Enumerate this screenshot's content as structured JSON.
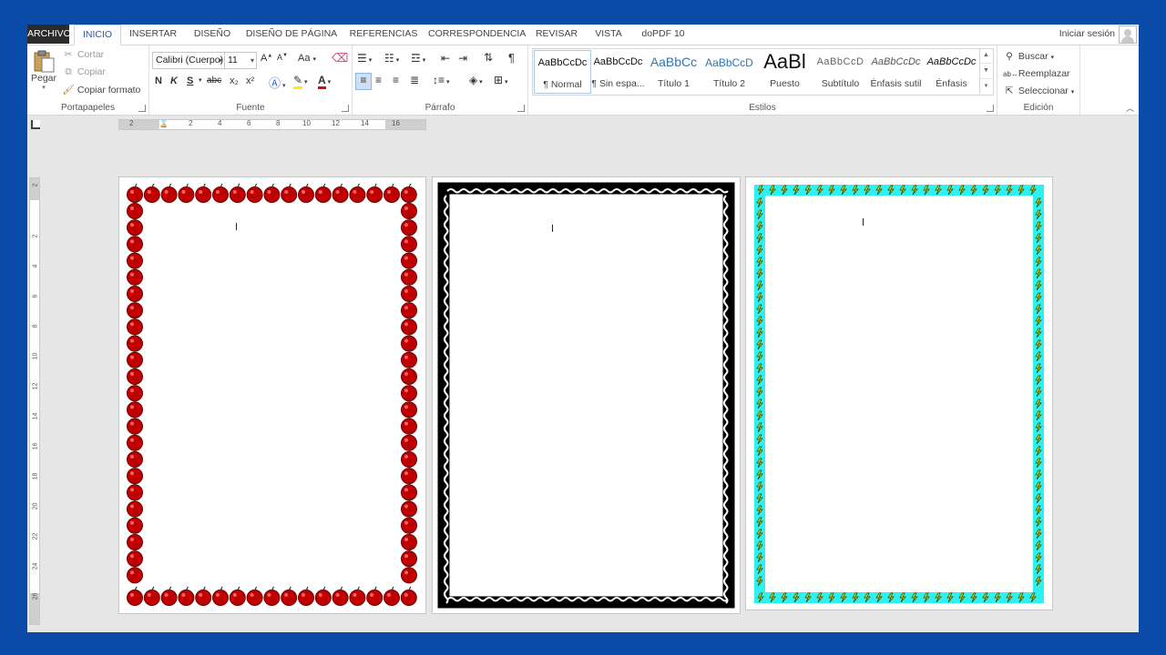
{
  "tabs": [
    "ARCHIVO",
    "INICIO",
    "INSERTAR",
    "DISEÑO",
    "DISEÑO DE PÁGINA",
    "REFERENCIAS",
    "CORRESPONDENCIA",
    "REVISAR",
    "VISTA",
    "doPDF 10"
  ],
  "active_tab": "INICIO",
  "signin": "Iniciar sesión",
  "clipboard": {
    "paste": "Pegar",
    "cut": "Cortar",
    "copy": "Copiar",
    "format_painter": "Copiar formato",
    "label": "Portapapeles"
  },
  "font": {
    "name": "Calibri (Cuerpo)",
    "size": "11",
    "bold": "N",
    "italic": "K",
    "underline": "S",
    "strike": "abc",
    "sub": "x₂",
    "sup": "x²",
    "case": "Aa",
    "label": "Fuente"
  },
  "paragraph": {
    "label": "Párrafo",
    "pilcrow": "¶"
  },
  "styles": {
    "label": "Estilos",
    "items": [
      {
        "sample": "AaBbCcDc",
        "name": "¶ Normal"
      },
      {
        "sample": "AaBbCcDc",
        "name": "¶ Sin espa..."
      },
      {
        "sample": "AaBbCc",
        "name": "Título 1"
      },
      {
        "sample": "AaBbCcD",
        "name": "Título 2"
      },
      {
        "sample": "AaBl",
        "name": "Puesto"
      },
      {
        "sample": "AaBbCcD",
        "name": "Subtítulo"
      },
      {
        "sample": "AaBbCcDc",
        "name": "Énfasis sutil"
      },
      {
        "sample": "AaBbCcDc",
        "name": "Énfasis"
      }
    ]
  },
  "editing": {
    "find": "Buscar",
    "replace": "Reemplazar",
    "select": "Seleccionar",
    "label": "Edición"
  },
  "ruler_h": [
    "2",
    "2",
    "4",
    "6",
    "8",
    "10",
    "12",
    "14",
    "16"
  ],
  "ruler_v": [
    "2",
    "2",
    "4",
    "6",
    "8",
    "10",
    "12",
    "14",
    "16",
    "18",
    "20",
    "22",
    "24",
    "26"
  ],
  "pages": [
    {
      "border": "apples",
      "color": "#c00000"
    },
    {
      "border": "black-vine",
      "color": "#000000"
    },
    {
      "border": "lightning",
      "color": "#2ff0f0"
    }
  ],
  "colors": {
    "accent": "#2b579a",
    "background": "#0a4ba8",
    "file_tab": "#2b2b2b"
  }
}
